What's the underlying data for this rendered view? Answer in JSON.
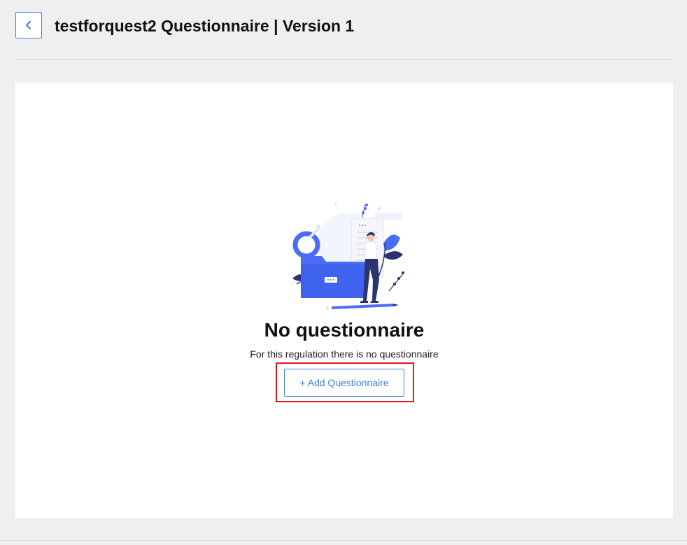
{
  "header": {
    "title": "testforquest2 Questionnaire | Version 1",
    "back_icon": "chevron-left-icon"
  },
  "empty_state": {
    "title": "No questionnaire",
    "subtitle": "For this regulation there is no questionnaire",
    "add_button_label": "+ Add Questionnaire",
    "illustration": "person-with-folder-illustration"
  },
  "colors": {
    "accent": "#3f7ee0",
    "highlight": "#e0141e",
    "background": "#efefef",
    "panel": "#ffffff",
    "illustration_blue": "#4a6cf7",
    "illustration_navy": "#2c3470"
  }
}
